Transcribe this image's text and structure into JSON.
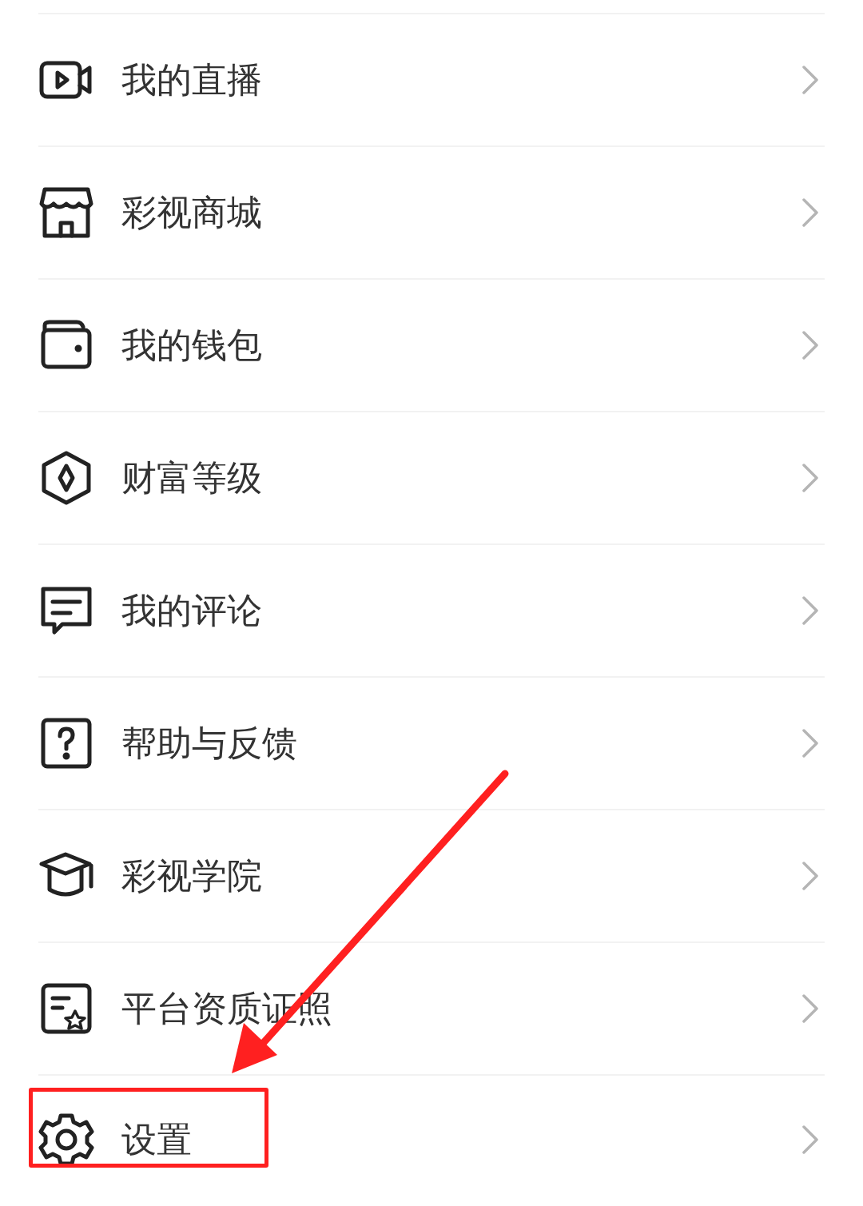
{
  "menu": [
    {
      "label": "我的直播",
      "highlighted": false
    },
    {
      "label": "彩视商城",
      "highlighted": false
    },
    {
      "label": "我的钱包",
      "highlighted": false
    },
    {
      "label": "财富等级",
      "highlighted": false
    },
    {
      "label": "我的评论",
      "highlighted": false
    },
    {
      "label": "帮助与反馈",
      "highlighted": false
    },
    {
      "label": "彩视学院",
      "highlighted": false
    },
    {
      "label": "平台资质证照",
      "highlighted": false
    },
    {
      "label": "设置",
      "highlighted": true
    }
  ]
}
